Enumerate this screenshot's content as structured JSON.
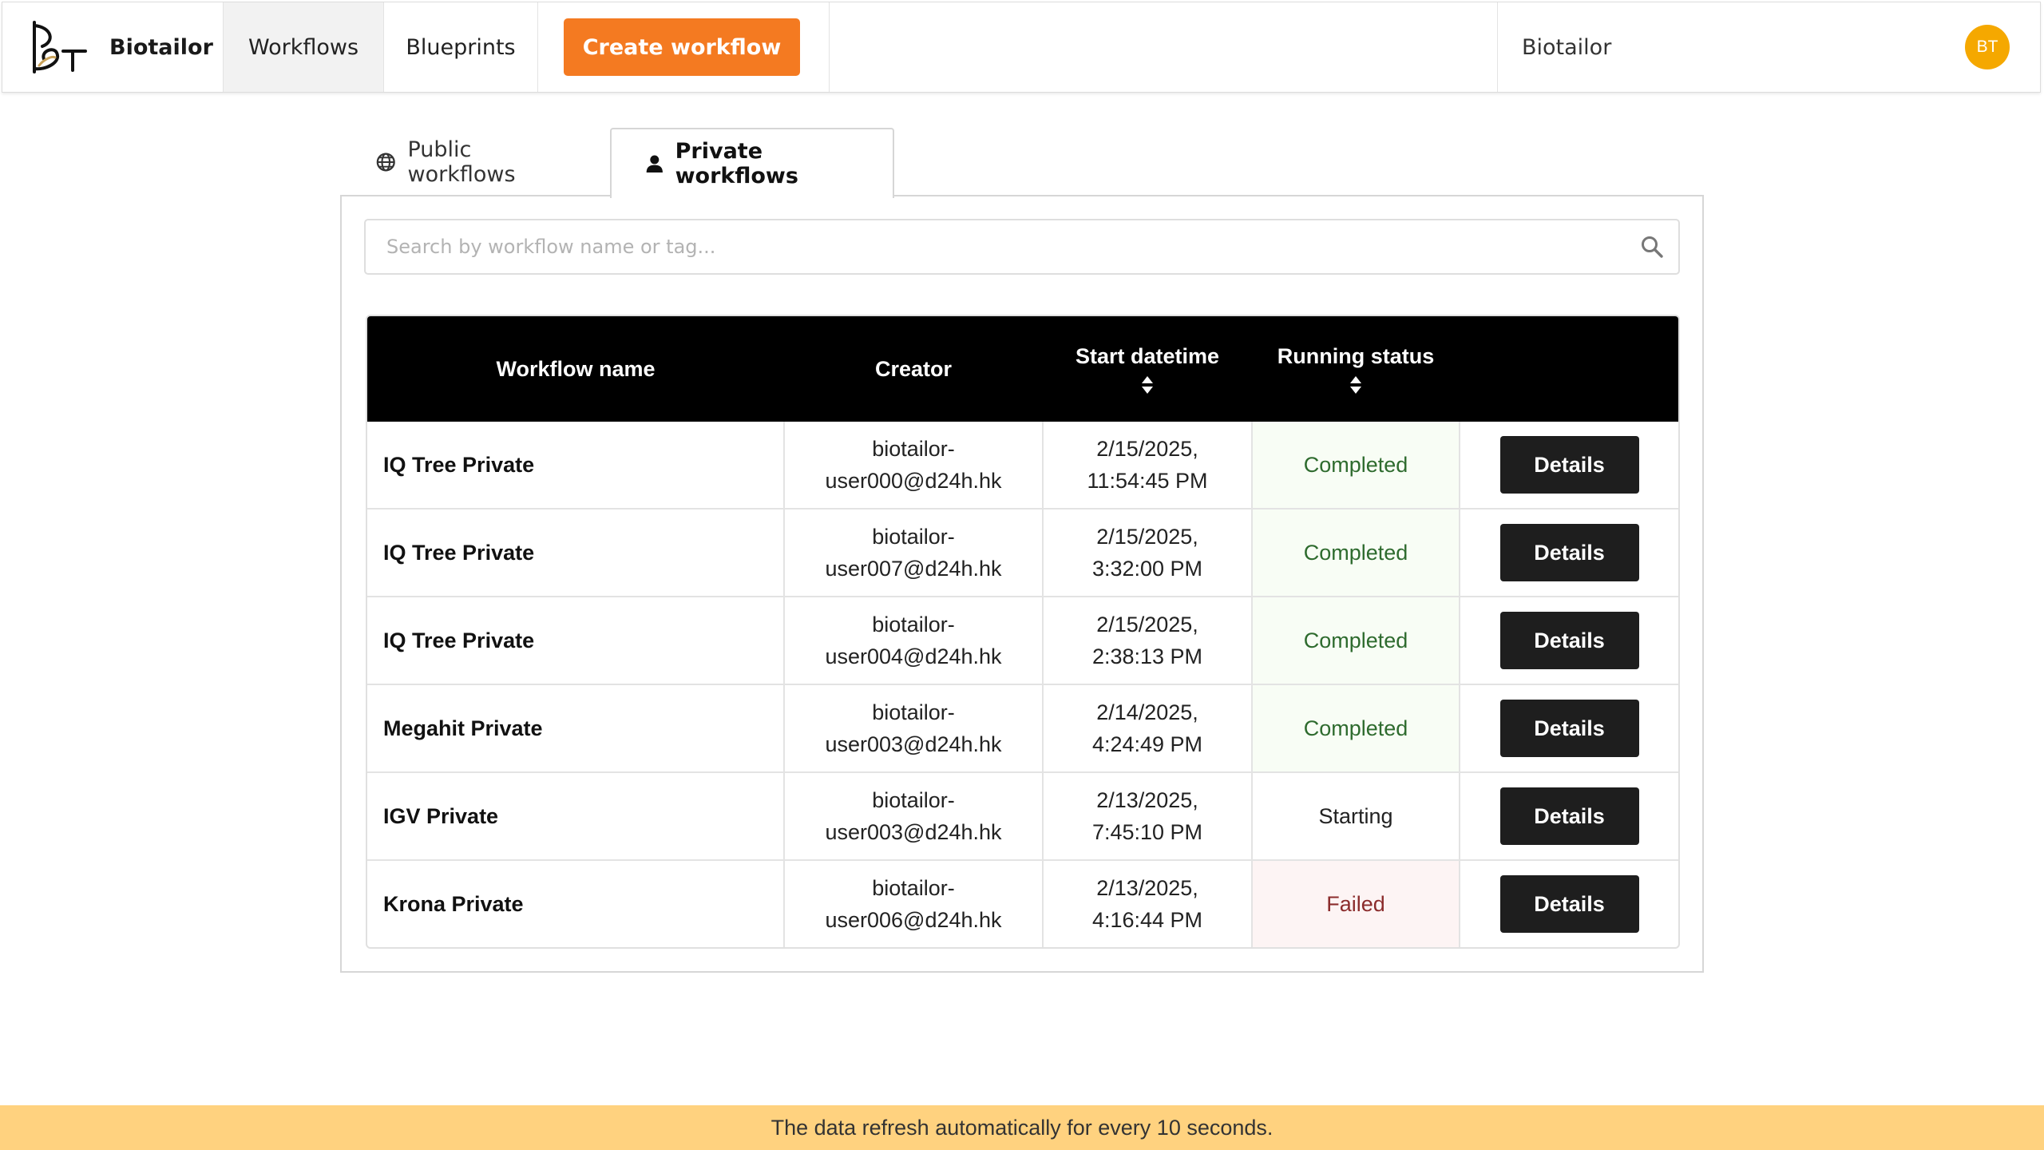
{
  "nav": {
    "brand": "Biotailor",
    "workflows": "Workflows",
    "blueprints": "Blueprints",
    "create_button": "Create workflow",
    "user_name": "Biotailor",
    "avatar_initials": "BT",
    "accent_color": "#f47a21"
  },
  "tabs": {
    "public": "Public workflows",
    "private": "Private workflows",
    "active": "private"
  },
  "search": {
    "placeholder": "Search by workflow name or tag..."
  },
  "table": {
    "headers": {
      "name": "Workflow name",
      "creator": "Creator",
      "start": "Start datetime",
      "status": "Running status"
    },
    "rows": [
      {
        "name": "IQ Tree Private",
        "creator_1": "biotailor-",
        "creator_2": "user000@d24h.hk",
        "date": "2/15/2025,",
        "time": "11:54:45 PM",
        "status": "Completed",
        "action": "Details"
      },
      {
        "name": "IQ Tree Private",
        "creator_1": "biotailor-",
        "creator_2": "user007@d24h.hk",
        "date": "2/15/2025,",
        "time": "3:32:00 PM",
        "status": "Completed",
        "action": "Details"
      },
      {
        "name": "IQ Tree Private",
        "creator_1": "biotailor-",
        "creator_2": "user004@d24h.hk",
        "date": "2/15/2025,",
        "time": "2:38:13 PM",
        "status": "Completed",
        "action": "Details"
      },
      {
        "name": "Megahit Private",
        "creator_1": "biotailor-",
        "creator_2": "user003@d24h.hk",
        "date": "2/14/2025,",
        "time": "4:24:49 PM",
        "status": "Completed",
        "action": "Details"
      },
      {
        "name": "IGV Private",
        "creator_1": "biotailor-",
        "creator_2": "user003@d24h.hk",
        "date": "2/13/2025,",
        "time": "7:45:10 PM",
        "status": "Starting",
        "action": "Details"
      },
      {
        "name": "Krona Private",
        "creator_1": "biotailor-",
        "creator_2": "user006@d24h.hk",
        "date": "2/13/2025,",
        "time": "4:16:44 PM",
        "status": "Failed",
        "action": "Details"
      }
    ]
  },
  "banner": {
    "text": "The data refresh automatically for every 10 seconds."
  }
}
